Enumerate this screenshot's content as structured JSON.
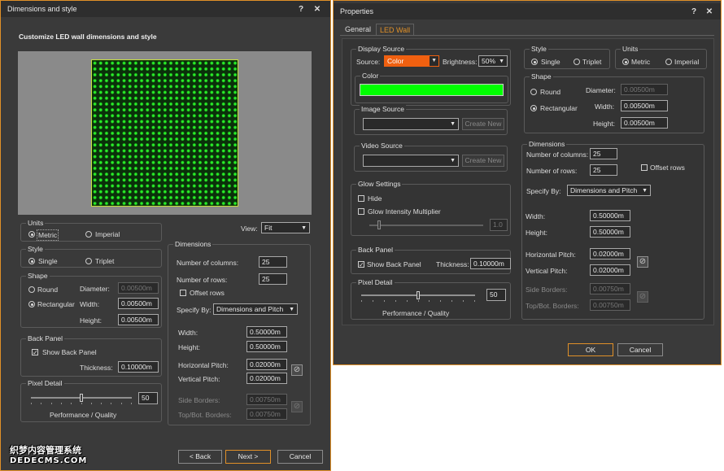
{
  "left": {
    "title": "Dimensions and style",
    "help": "?",
    "close": "✕",
    "heading": "Customize LED wall dimensions and style",
    "units": {
      "title": "Units",
      "metric": "Metric",
      "imperial": "Imperial"
    },
    "view": {
      "label": "View:",
      "value": "Fit"
    },
    "style": {
      "title": "Style",
      "single": "Single",
      "triplet": "Triplet"
    },
    "shape": {
      "title": "Shape",
      "round": "Round",
      "rectangular": "Rectangular",
      "diameter_label": "Diameter:",
      "diameter": "0.00500m",
      "width_label": "Width:",
      "width": "0.00500m",
      "height_label": "Height:",
      "height": "0.00500m"
    },
    "back_panel": {
      "title": "Back Panel",
      "show": "Show Back Panel",
      "thickness_label": "Thickness:",
      "thickness": "0.10000m"
    },
    "pixel_detail": {
      "title": "Pixel Detail",
      "value": "50",
      "caption": "Performance / Quality",
      "level": 0.5
    },
    "dimensions": {
      "title": "Dimensions",
      "columns_label": "Number of columns:",
      "columns": "25",
      "rows_label": "Number of rows:",
      "rows": "25",
      "offset_rows": "Offset rows",
      "specify_label": "Specify By:",
      "specify": "Dimensions and Pitch",
      "width_label": "Width:",
      "width": "0.50000m",
      "height_label": "Height:",
      "height": "0.50000m",
      "hpitch_label": "Horizontal Pitch:",
      "hpitch": "0.02000m",
      "vpitch_label": "Vertical Pitch:",
      "vpitch": "0.02000m",
      "side_label": "Side Borders:",
      "side": "0.00750m",
      "topbot_label": "Top/Bot. Borders:",
      "topbot": "0.00750m"
    },
    "back_button": "< Back",
    "next_button": "Next >",
    "cancel_button": "Cancel",
    "colors": {
      "led": "#18e018",
      "preview_bg": "#8a8a8a",
      "frame": "#c8e040"
    }
  },
  "right": {
    "title": "Properties",
    "help": "?",
    "close": "✕",
    "tabs": [
      "General",
      "LED Wall"
    ],
    "display_source": {
      "title": "Display Source",
      "source_label": "Source:",
      "source": "Color",
      "brightness_label": "Brightness:",
      "brightness": "50%"
    },
    "color": {
      "title": "Color",
      "value": "#00ff00"
    },
    "image_source": {
      "title": "Image Source",
      "create": "Create New"
    },
    "video_source": {
      "title": "Video Source",
      "create": "Create New"
    },
    "glow": {
      "title": "Glow Settings",
      "hide": "Hide",
      "multiplier": "Glow Intensity Multiplier",
      "value": "1.0"
    },
    "back_panel": {
      "title": "Back Panel",
      "show": "Show Back Panel",
      "thickness_label": "Thickness:",
      "thickness": "0.10000m"
    },
    "pixel_detail": {
      "title": "Pixel Detail",
      "value": "50",
      "caption": "Performance / Quality",
      "level": 0.5
    },
    "style": {
      "title": "Style",
      "single": "Single",
      "triplet": "Triplet"
    },
    "units": {
      "title": "Units",
      "metric": "Metric",
      "imperial": "Imperial"
    },
    "shape": {
      "title": "Shape",
      "round": "Round",
      "rectangular": "Rectangular",
      "diameter_label": "Diameter:",
      "diameter": "0.00500m",
      "width_label": "Width:",
      "width": "0.00500m",
      "height_label": "Height:",
      "height": "0.00500m"
    },
    "dimensions": {
      "title": "Dimensions",
      "columns_label": "Number of columns:",
      "columns": "25",
      "rows_label": "Number of rows:",
      "rows": "25",
      "offset_rows": "Offset rows",
      "specify_label": "Specify By:",
      "specify": "Dimensions and Pitch",
      "width_label": "Width:",
      "width": "0.50000m",
      "height_label": "Height:",
      "height": "0.50000m",
      "hpitch_label": "Horizontal Pitch:",
      "hpitch": "0.02000m",
      "vpitch_label": "Vertical Pitch:",
      "vpitch": "0.02000m",
      "side_label": "Side Borders:",
      "side": "0.00750m",
      "topbot_label": "Top/Bot. Borders:",
      "topbot": "0.00750m"
    },
    "ok_button": "OK",
    "cancel_button": "Cancel"
  },
  "watermark": {
    "line1": "织梦内容管理系统",
    "line2": "DEDECMS.COM"
  }
}
